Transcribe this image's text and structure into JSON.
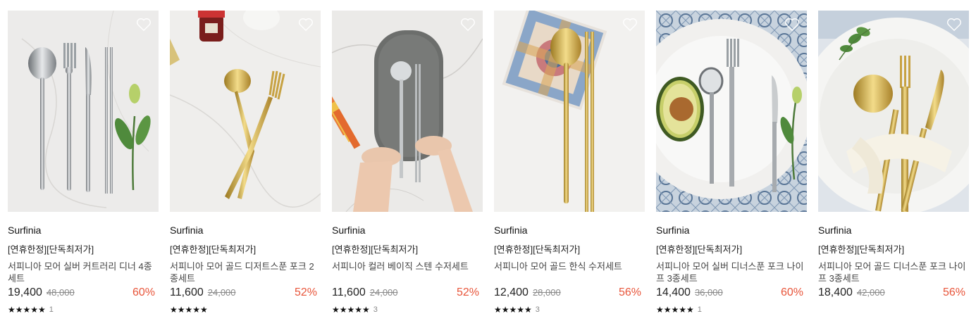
{
  "products": [
    {
      "brand": "Surfinia",
      "tag": "[연휴한정][단독최저가]",
      "title": "서피니아 모어 실버 커트러리 디너 4종세트",
      "price": "19,400",
      "orig": "48,000",
      "discount": "60%",
      "stars": "★★★★★",
      "reviews": "1",
      "image": {
        "bg": "#ecebea",
        "metal": "silver"
      }
    },
    {
      "brand": "Surfinia",
      "tag": "[연휴한정][단독최저가]",
      "title": "서피니아 모어 골드 디저트스푼 포크 2종세트",
      "price": "11,600",
      "orig": "24,000",
      "discount": "52%",
      "stars": "★★★★★",
      "reviews": "",
      "image": {
        "bg": "#efeeec",
        "metal": "gold"
      }
    },
    {
      "brand": "Surfinia",
      "tag": "[연휴한정][단독최저가]",
      "title": "서피니아 컬러 베이직 스텐 수저세트",
      "price": "11,600",
      "orig": "24,000",
      "discount": "52%",
      "stars": "★★★★★",
      "reviews": "3",
      "image": {
        "bg": "#ebeae8",
        "metal": "silver"
      }
    },
    {
      "brand": "Surfinia",
      "tag": "[연휴한정][단독최저가]",
      "title": "서피니아 모어 골드 한식 수저세트",
      "price": "12,400",
      "orig": "28,000",
      "discount": "56%",
      "stars": "★★★★★",
      "reviews": "3",
      "image": {
        "bg": "#f2f1ef",
        "metal": "gold"
      }
    },
    {
      "brand": "Surfinia",
      "tag": "[연휴한정][단독최저가]",
      "title": "서피니아 모어 실버 디너스푼 포크 나이프 3종세트",
      "price": "14,400",
      "orig": "36,000",
      "discount": "60%",
      "stars": "★★★★★",
      "reviews": "1",
      "image": {
        "bg": "#c8d2dc",
        "metal": "silver"
      }
    },
    {
      "brand": "Surfinia",
      "tag": "[연휴한정][단독최저가]",
      "title": "서피니아 모어 골드 디너스푼 포크 나이프 3종세트",
      "price": "18,400",
      "orig": "42,000",
      "discount": "56%",
      "stars": "",
      "reviews": "",
      "image": {
        "bg": "#dfe4ea",
        "metal": "gold"
      }
    }
  ],
  "icons": {
    "heart": "heart-outline-icon",
    "star": "star-icon"
  },
  "colors": {
    "discount": "#e8553a",
    "silver": "#9ea2a6",
    "gold": "#c9a445"
  }
}
